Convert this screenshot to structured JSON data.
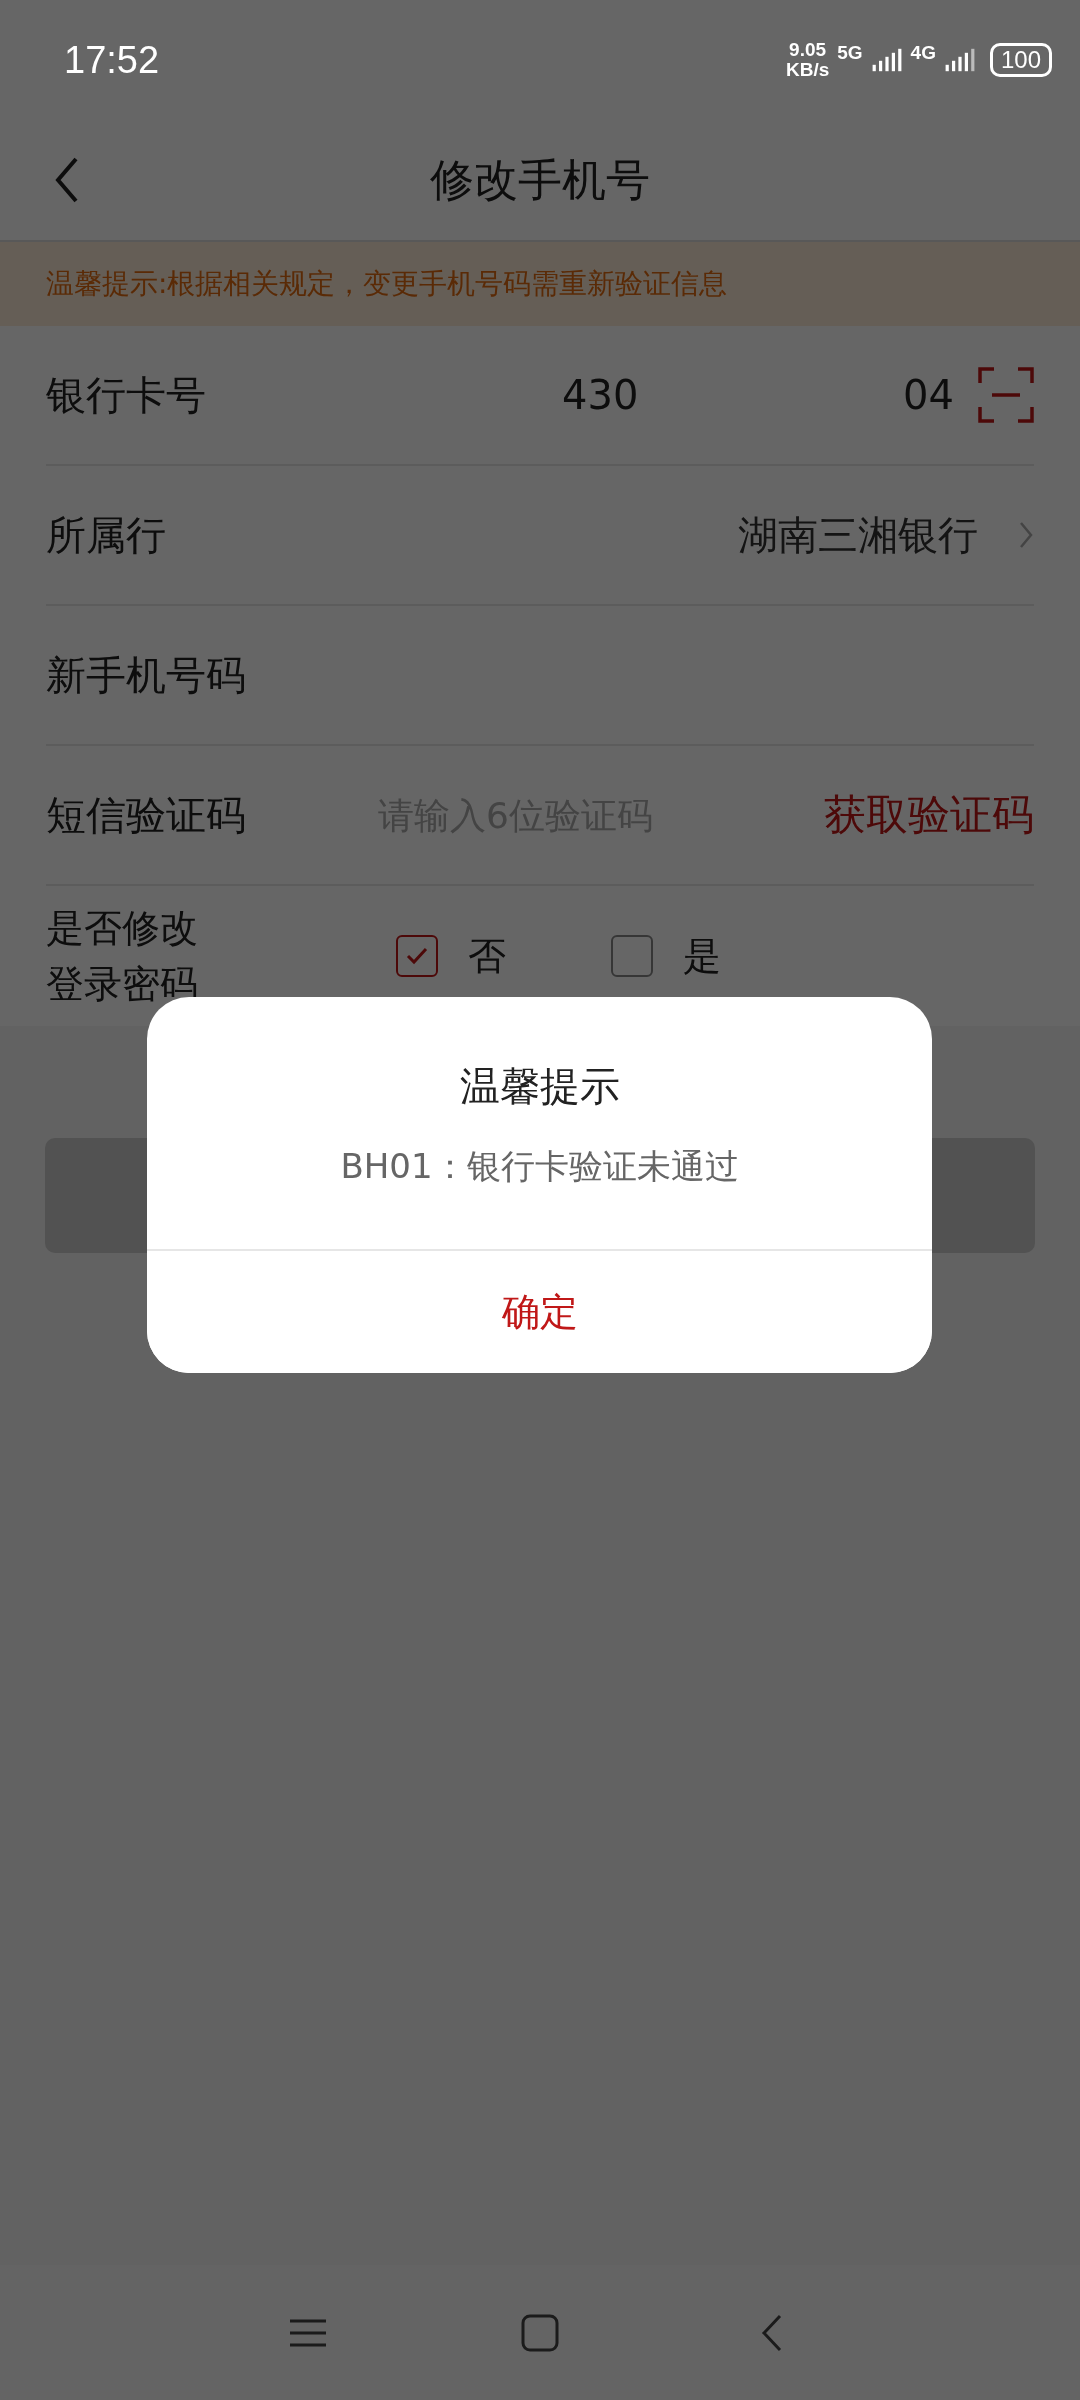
{
  "status_bar": {
    "time": "17:52",
    "speed": "9.05",
    "speed_unit": "KB/s",
    "net1": "5G",
    "net2": "4G",
    "battery": "100"
  },
  "header": {
    "title": "修改手机号"
  },
  "notice": "温馨提示:根据相关规定，变更手机号码需重新验证信息",
  "form": {
    "card": {
      "label": "银行卡号",
      "value_start": "430",
      "value_end": "04"
    },
    "bank": {
      "label": "所属行",
      "value": "湖南三湘银行"
    },
    "phone": {
      "label": "新手机号码"
    },
    "sms": {
      "label": "短信验证码",
      "placeholder": "请输入6位验证码",
      "action": "获取验证码"
    },
    "password": {
      "label_lines": [
        "是否修改",
        "登录密码"
      ],
      "options": [
        {
          "label": "否",
          "selected": true
        },
        {
          "label": "是",
          "selected": false
        }
      ]
    }
  },
  "dialog": {
    "title": "温馨提示",
    "message": "BH01：银行卡验证未通过",
    "button": "确定"
  }
}
